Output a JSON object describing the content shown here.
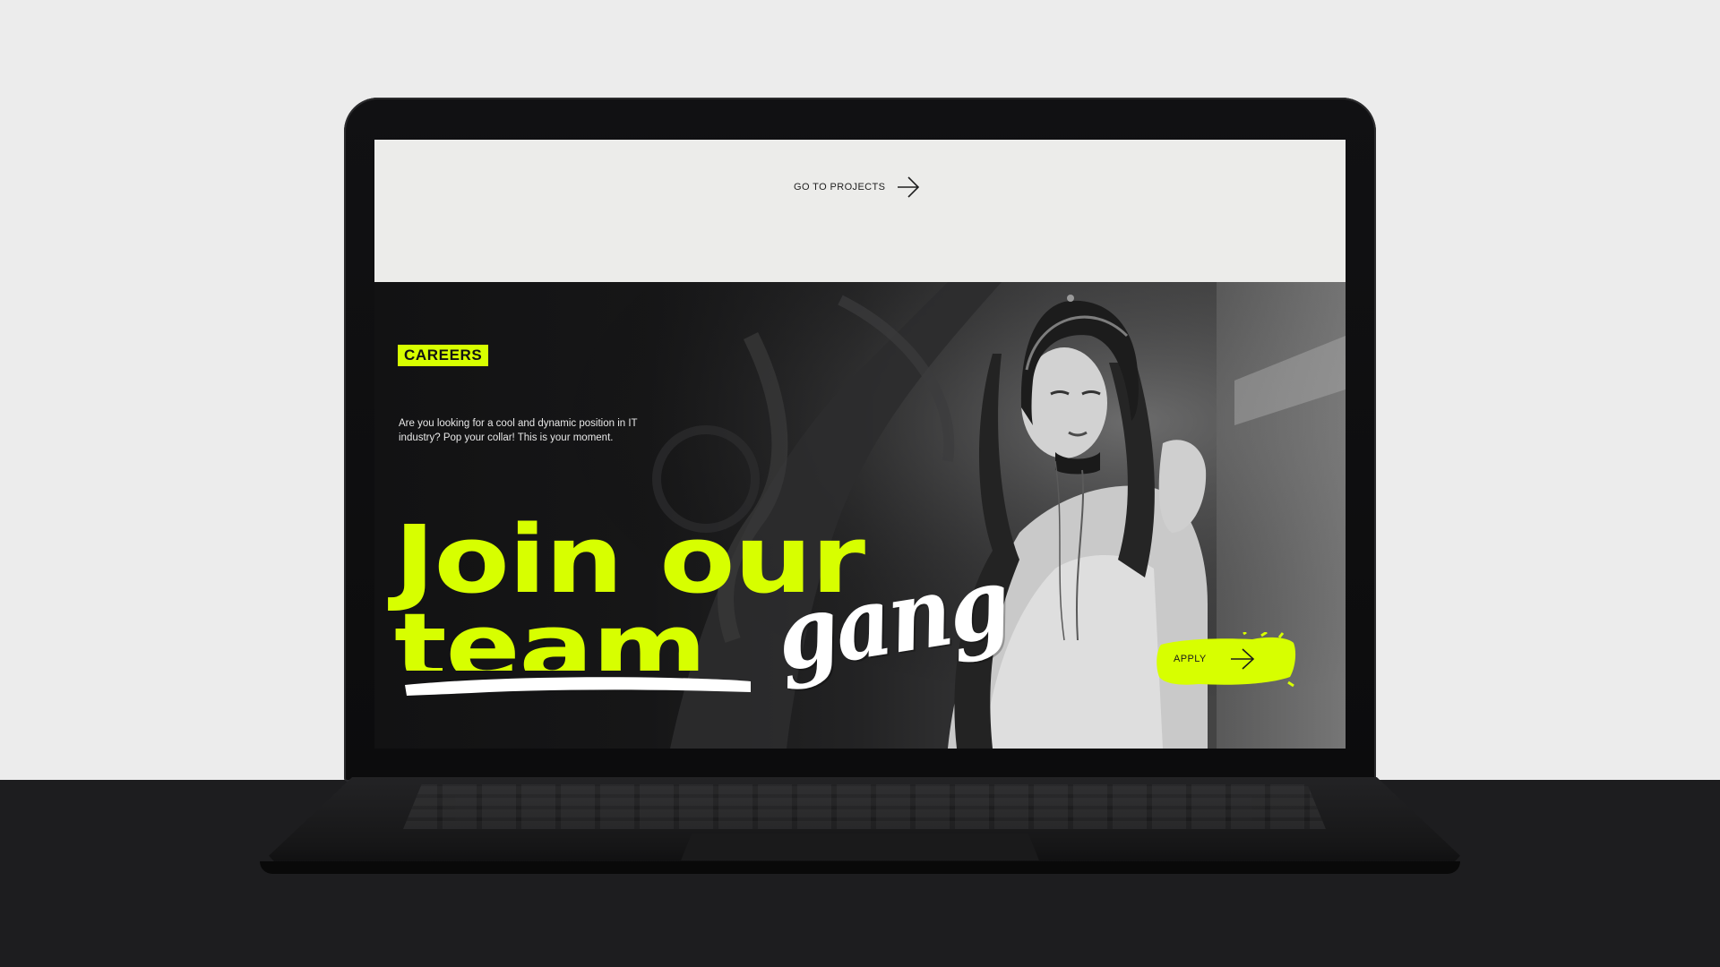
{
  "screen": {
    "top_link": {
      "label": "GO TO PROJECTS",
      "icon": "arrow-right-icon"
    },
    "hero": {
      "badge": "CAREERS",
      "intro": "Are you looking for a cool and dynamic position in IT industry? Pop your collar! This is your moment.",
      "headline_line1": "Join our",
      "headline_struck": "team",
      "headline_script": "gang",
      "apply_label": "APPLY",
      "apply_icon": "arrow-right-icon"
    }
  },
  "colors": {
    "accent": "#d7ff00",
    "background": "#ececec",
    "dark": "#121213",
    "desk": "#1d1d1f"
  }
}
